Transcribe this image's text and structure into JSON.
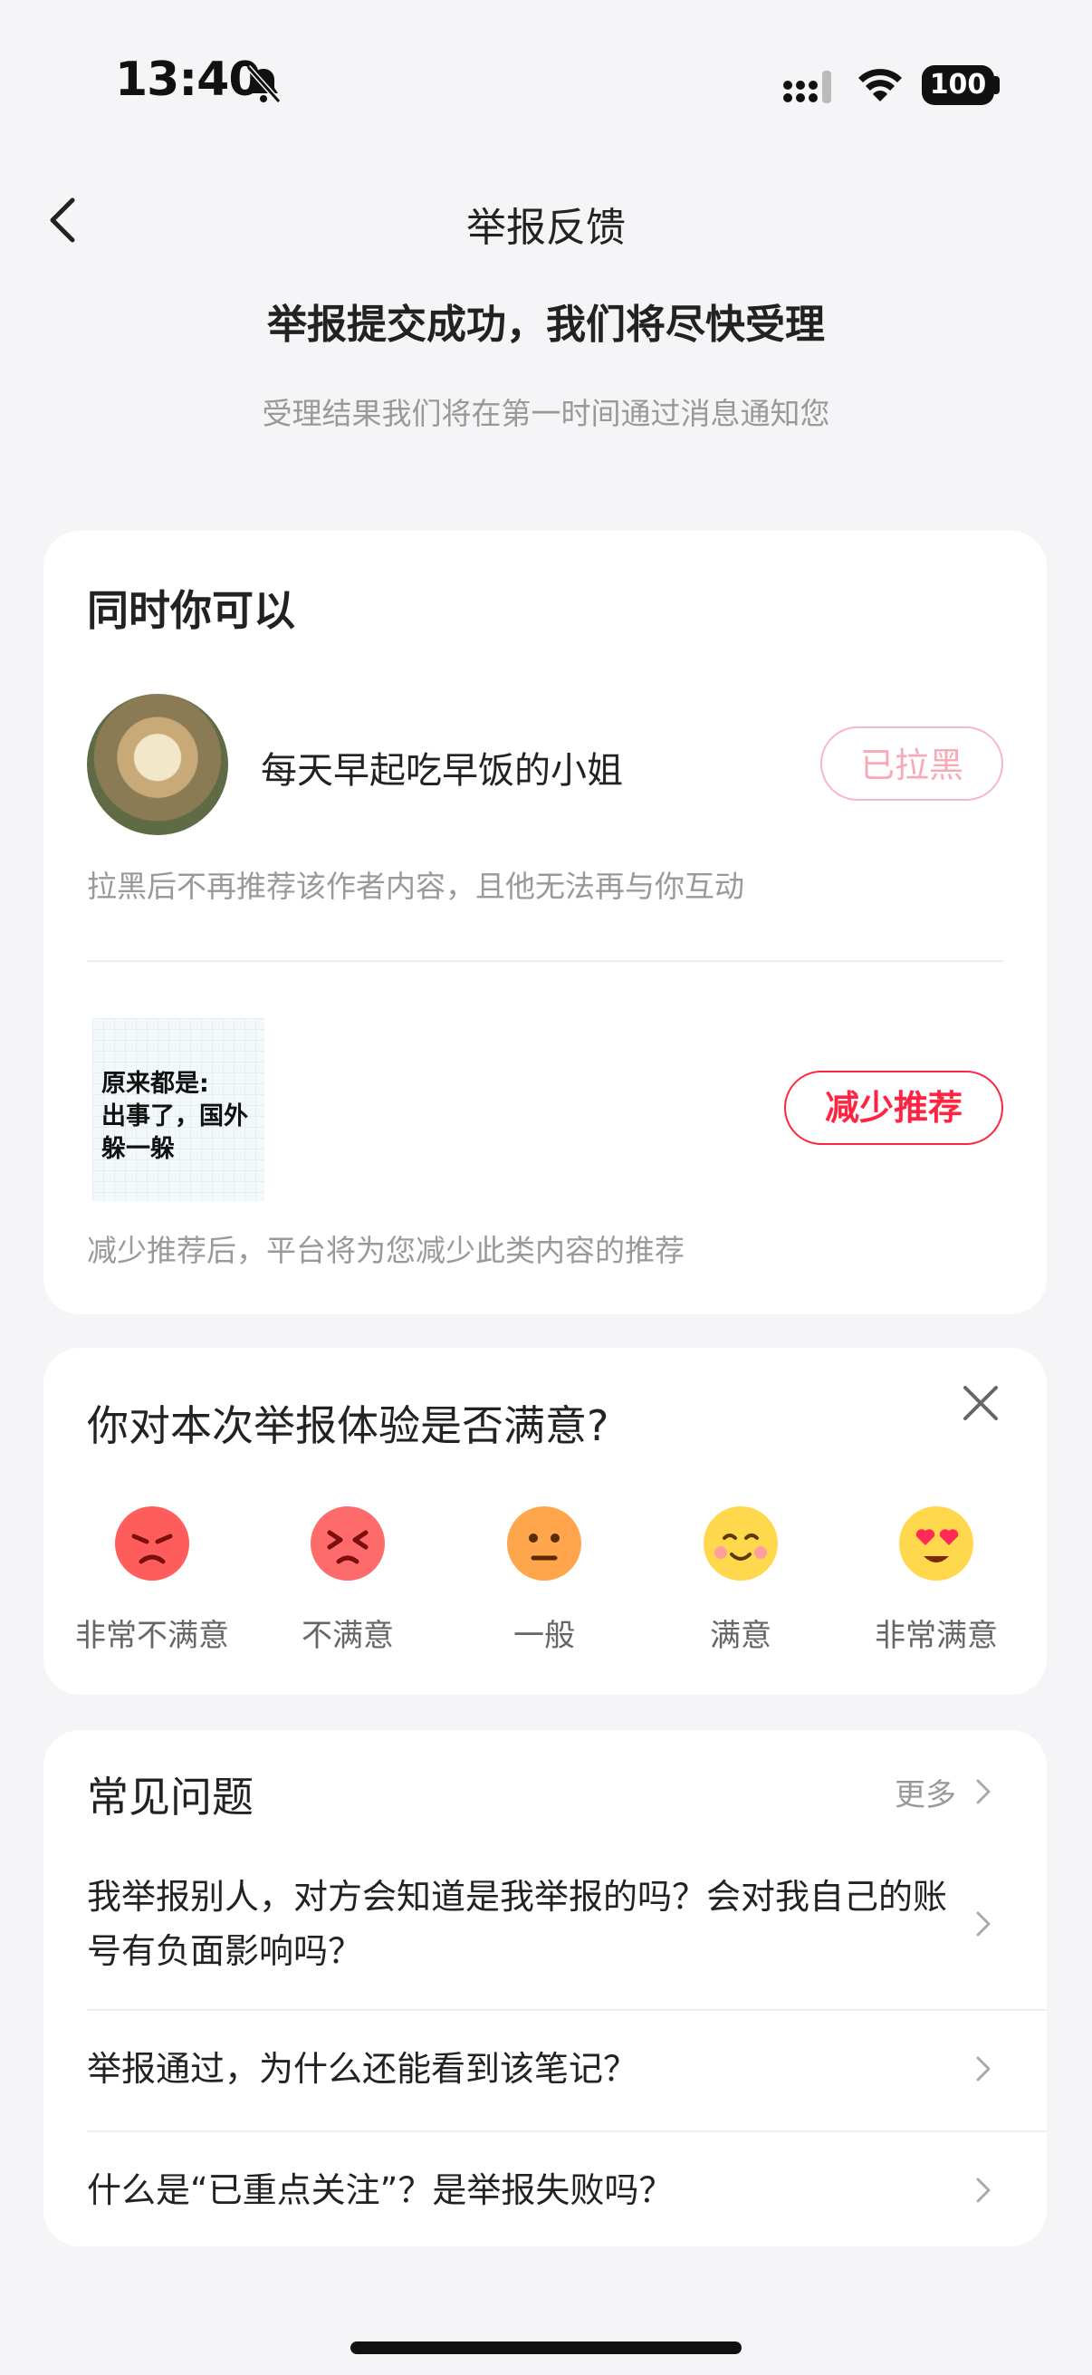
{
  "status_bar": {
    "time": "13:40",
    "battery": "100"
  },
  "header": {
    "title": "举报反馈"
  },
  "result": {
    "headline": "举报提交成功，我们将尽快受理",
    "subline": "受理结果我们将在第一时间通过消息通知您"
  },
  "actions_card": {
    "title": "同时你可以",
    "author_name": "每天早起吃早饭的小姐",
    "blocked_button": "已拉黑",
    "block_note": "拉黑后不再推荐该作者内容，且他无法再与你互动",
    "thumb_lines": [
      "原来都是:",
      "出事了，国外",
      "躲一躲"
    ],
    "reduce_button": "减少推荐",
    "reduce_note": "减少推荐后，平台将为您减少此类内容的推荐"
  },
  "survey": {
    "question": "你对本次举报体验是否满意?",
    "options": [
      {
        "label": "非常不满意",
        "icon": "angry-face-icon",
        "color": "#ff5a5f"
      },
      {
        "label": "不满意",
        "icon": "frustrated-face-icon",
        "color": "#ff6e6e"
      },
      {
        "label": "一般",
        "icon": "neutral-face-icon",
        "color": "#ffa64d"
      },
      {
        "label": "满意",
        "icon": "smiling-face-icon",
        "color": "#ffd84d"
      },
      {
        "label": "非常满意",
        "icon": "heart-eyes-face-icon",
        "color": "#ffd84d"
      }
    ]
  },
  "faq": {
    "title": "常见问题",
    "more": "更多",
    "items": [
      "我举报别人，对方会知道是我举报的吗？会对我自己的账号有负面影响吗？",
      "举报通过，为什么还能看到该笔记？",
      "什么是“已重点关注”？是举报失败吗？"
    ]
  }
}
